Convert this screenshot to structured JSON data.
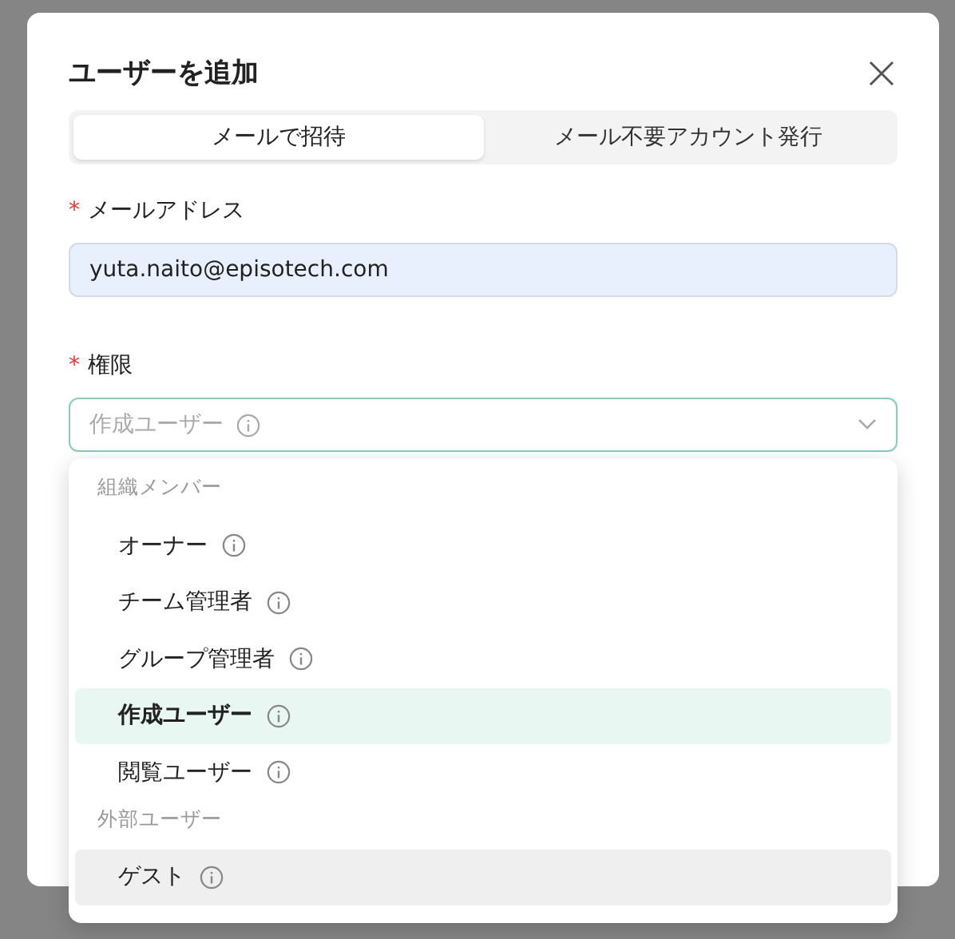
{
  "dialog": {
    "title": "ユーザーを追加",
    "tabs": [
      {
        "label": "メールで招待",
        "selected": true
      },
      {
        "label": "メール不要アカウント発行",
        "selected": false
      }
    ],
    "email": {
      "label": "メールアドレス",
      "required_mark": "*",
      "value": "yuta.naito@episotech.com"
    },
    "permission": {
      "label": "権限",
      "required_mark": "*",
      "placeholder": "作成ユーザー",
      "expanded": true,
      "groups": [
        {
          "header": "組織メンバー",
          "options": [
            {
              "label": "オーナー",
              "selected": false,
              "hovered": false
            },
            {
              "label": "チーム管理者",
              "selected": false,
              "hovered": false
            },
            {
              "label": "グループ管理者",
              "selected": false,
              "hovered": false
            },
            {
              "label": "作成ユーザー",
              "selected": true,
              "hovered": false
            },
            {
              "label": "閲覧ユーザー",
              "selected": false,
              "hovered": false
            }
          ]
        },
        {
          "header": "外部ユーザー",
          "options": [
            {
              "label": "ゲスト",
              "selected": false,
              "hovered": true
            }
          ]
        }
      ]
    }
  }
}
